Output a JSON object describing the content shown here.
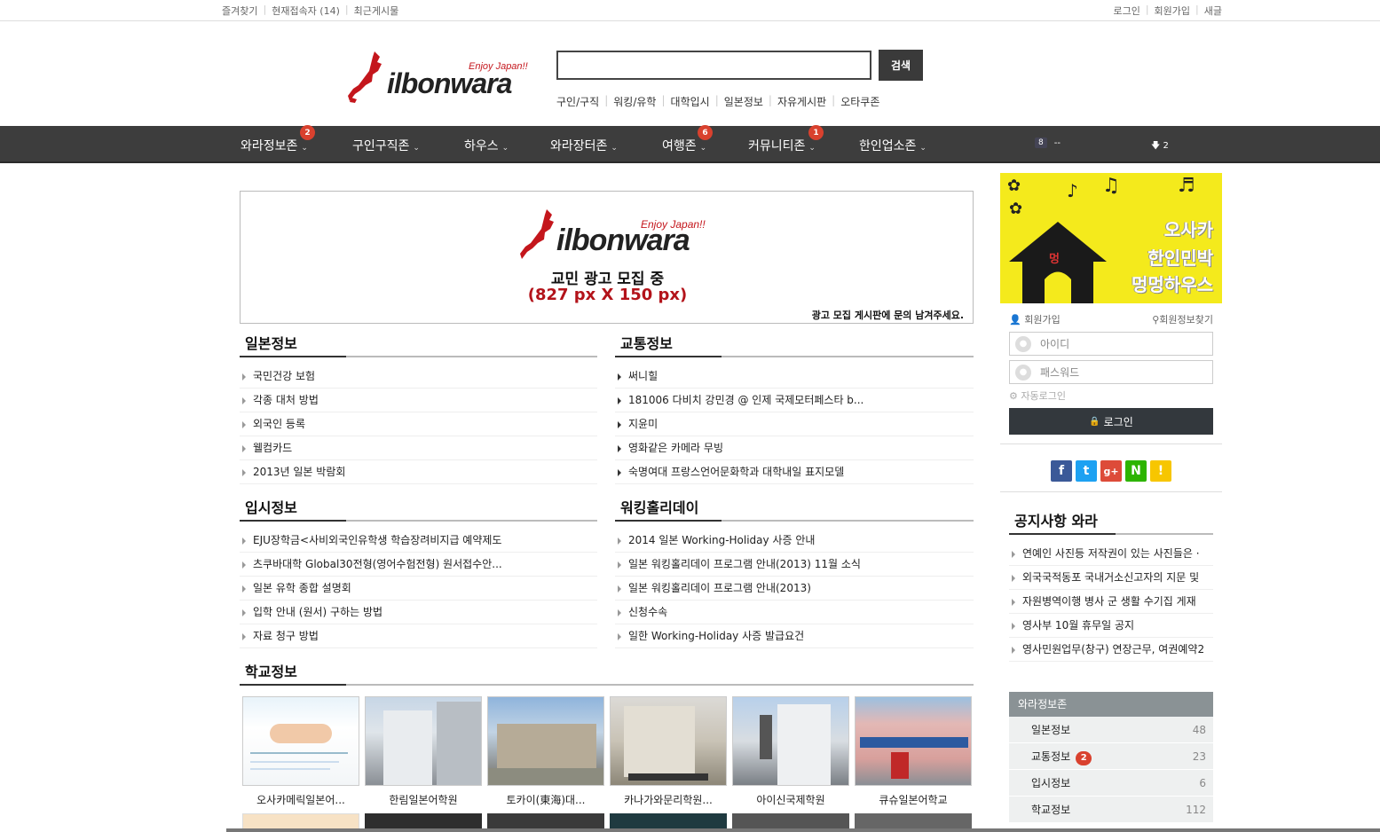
{
  "topbar": {
    "left_links": [
      "즐겨찾기",
      "현재접속자 (14)",
      "최근게시물"
    ],
    "right_links": [
      "로그인",
      "회원가입",
      "새글"
    ]
  },
  "header": {
    "logo_text": "ilbonwara",
    "logo_tagline": "Enjoy Japan!!",
    "search_placeholder": "",
    "search_button": "검색",
    "quick_links": [
      "구인/구직",
      "워킹/유학",
      "대학입시",
      "일본정보",
      "자유게시판",
      "오타쿠존"
    ]
  },
  "nav": {
    "items": [
      {
        "label": "와라정보존",
        "badge": "2"
      },
      {
        "label": "구인구직존",
        "badge": ""
      },
      {
        "label": "하우스",
        "badge": ""
      },
      {
        "label": "와라장터존",
        "badge": ""
      },
      {
        "label": "여행존",
        "badge": "6"
      },
      {
        "label": "커뮤니티존",
        "badge": "1"
      },
      {
        "label": "한인업소존",
        "badge": ""
      }
    ],
    "online_count": "8",
    "online_text": "--",
    "download_count": "2"
  },
  "banner": {
    "logo_text": "ilbonwara",
    "logo_tagline": "Enjoy Japan!!",
    "line1": "교민 광고 모집 중",
    "line2": "(827 px X 150 px)",
    "line3": "광고 모집 게시판에 문의 남겨주세요."
  },
  "sections": {
    "japan_info": {
      "title": "일본정보",
      "items": [
        "국민건강 보험",
        "각종 대처 방법",
        "외국인 등록",
        "웰컴카드",
        "2013년 일본 박람회"
      ]
    },
    "traffic_info": {
      "title": "교통정보",
      "items": [
        "써니힐",
        "181006 다비치 강민경 @ 인제 국제모터페스타 b...",
        "지윤미",
        "영화같은 카메라 무빙",
        "숙명여대 프랑스언어문화학과 대학내일 표지모델"
      ]
    },
    "admission_info": {
      "title": "입시정보",
      "items": [
        "EJU장학금<사비외국인유학생 학습장려비지급 예약제도",
        "츠쿠바대학 Global30전형(영어수험전형) 원서접수안...",
        "일본 유학 종합 설명회",
        "입학 안내 (원서) 구하는 방법",
        "자료 청구 방법"
      ]
    },
    "working_holiday": {
      "title": "워킹홀리데이",
      "items": [
        "2014 일본 Working-Holiday 사증 안내",
        "일본 워킹홀리데이 프로그램 안내(2013) 11월 소식",
        "일본 워킹홀리데이 프로그램 안내(2013)",
        "신청수속",
        "일한 Working-Holiday 사증 발급요건"
      ]
    },
    "school_info": {
      "title": "학교정보",
      "items": [
        "오사카메릭일본어...",
        "한림일본어학원",
        "토카이(東海)대...",
        "카나가와문리학원...",
        "아이신국제학원",
        "큐슈일본어학교"
      ]
    }
  },
  "sidebar": {
    "ad_lines": [
      "오사카",
      "한인민박",
      "멍멍하우스"
    ],
    "ad_small": "멍",
    "login": {
      "signup": "회원가입",
      "find": "회원정보찾기",
      "id_placeholder": "아이디",
      "pw_placeholder": "패스워드",
      "autologin": "자동로그인",
      "button": "로그인"
    },
    "share_icons": [
      "facebook-icon",
      "twitter-icon",
      "googleplus-icon",
      "naver-icon",
      "kakaostory-icon"
    ],
    "notice": {
      "title": "공지사항 와라",
      "items": [
        "연예인 사진등 저작권이 있는 사진들은 ·",
        "외국국적동포 국내거소신고자의 지문 및",
        "자원병역이행 병사 군 생활 수기집 게재",
        "영사부 10월 휴무일 공지",
        "영사민원업무(창구) 연장근무, 여권예약2"
      ]
    },
    "board": {
      "title": "와라정보존",
      "rows": [
        {
          "label": "일본정보",
          "count": "48",
          "badge": ""
        },
        {
          "label": "교통정보",
          "count": "23",
          "badge": "2"
        },
        {
          "label": "입시정보",
          "count": "6",
          "badge": ""
        },
        {
          "label": "학교정보",
          "count": "112",
          "badge": ""
        }
      ]
    }
  },
  "colors": {
    "nav_bg": "#3d3d3d",
    "badge": "#d9412e",
    "logo_red": "#c4161c",
    "ad_yellow": "#f4ea1c"
  }
}
